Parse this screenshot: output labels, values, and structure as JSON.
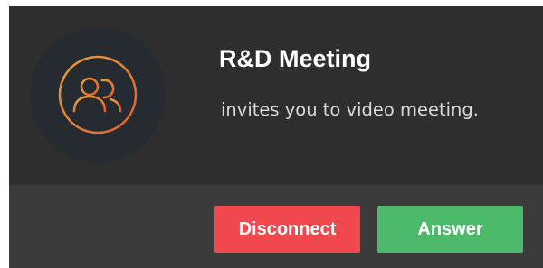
{
  "invite": {
    "title": "R&D Meeting",
    "message": "invites you to video meeting.",
    "avatar_icon": "group-icon"
  },
  "actions": {
    "disconnect_label": "Disconnect",
    "answer_label": "Answer"
  },
  "colors": {
    "background": "#2e2e2e",
    "action_bar": "#3b3b3b",
    "avatar_circle": "#262a31",
    "icon_gradient_start": "#e09a3a",
    "icon_gradient_end": "#e46a2e",
    "disconnect": "#f0484c",
    "answer": "#4cb96b"
  }
}
